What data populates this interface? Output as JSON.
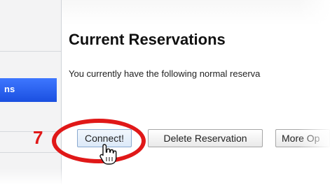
{
  "sidebar": {
    "active_item_label": "ns"
  },
  "main": {
    "title": "Current Reservations",
    "description": "You currently have the following normal reserva"
  },
  "buttons": {
    "connect": "Connect!",
    "delete": "Delete Reservation",
    "more": "More Op"
  },
  "annotation": {
    "step": "7",
    "highlight_color": "#e01818"
  },
  "icons": [
    "hand-pointer-cursor-icon"
  ]
}
